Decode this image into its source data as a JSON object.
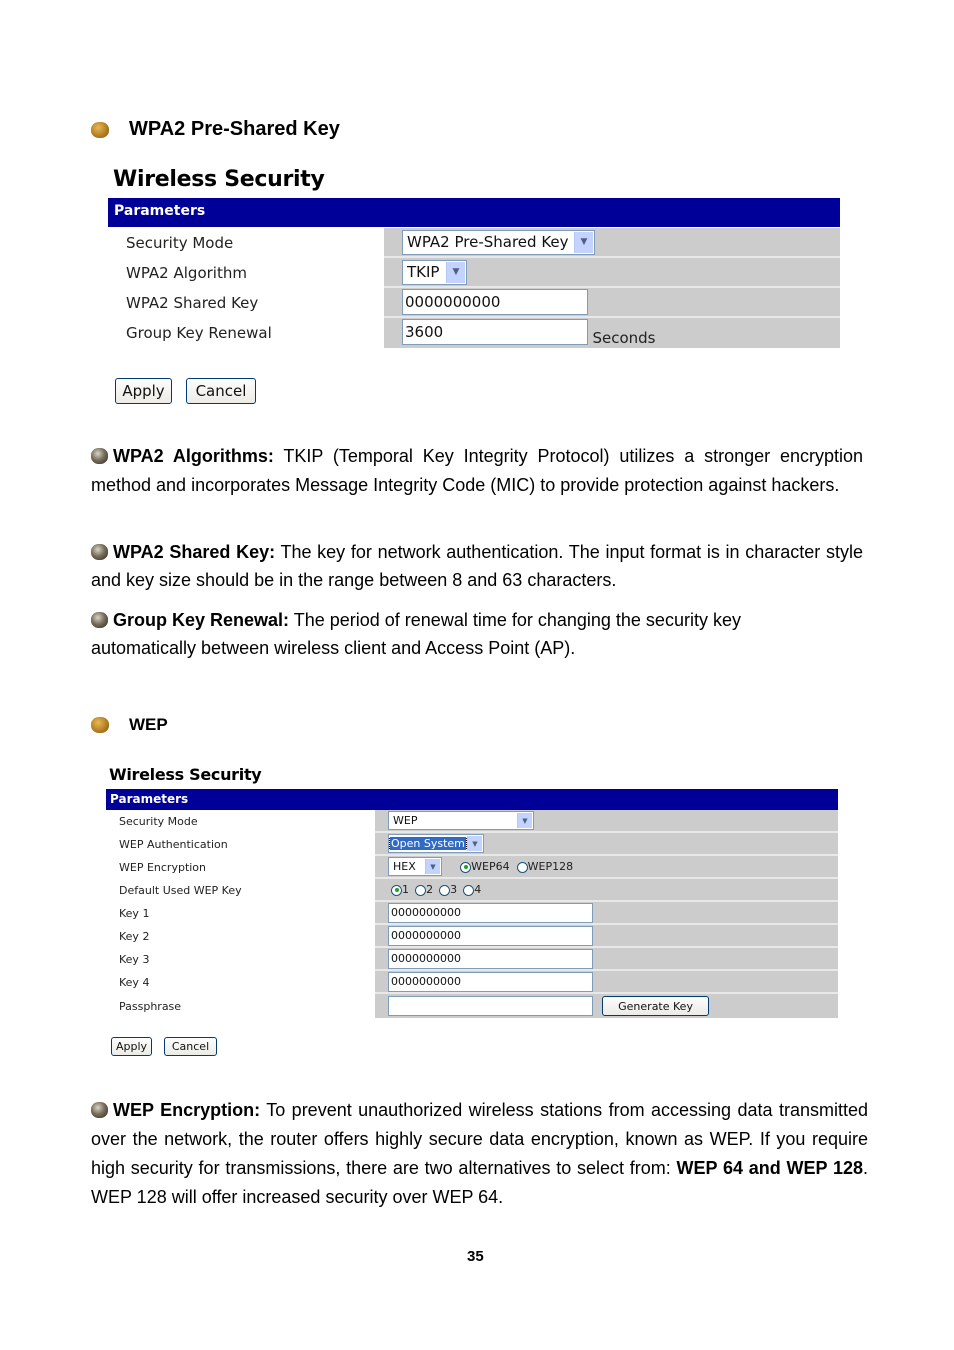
{
  "sections": {
    "wpa2": {
      "heading": "WPA2 Pre-Shared Key",
      "panel": {
        "title": "Wireless Security",
        "bar_label": "Parameters",
        "rows": [
          {
            "label": "Security Mode",
            "value": "WPA2 Pre-Shared Key",
            "type": "select"
          },
          {
            "label": "WPA2 Algorithm",
            "value": "TKIP",
            "type": "select"
          },
          {
            "label": "WPA2 Shared Key",
            "value": "0000000000",
            "type": "text"
          },
          {
            "label": "Group Key Renewal",
            "value": "3600",
            "type": "text",
            "suffix": "Seconds"
          }
        ],
        "apply_label": "Apply",
        "cancel_label": "Cancel"
      },
      "descriptions": [
        {
          "term": "WPA2 Algorithms:",
          "text": " TKIP (Temporal Key Integrity Protocol) utilizes a stronger encryption method and incorporates Message Integrity Code (MIC) to provide protection against hackers."
        },
        {
          "term": "WPA2 Shared Key:",
          "text": " The key for network authentication. The input format is in character style and key size should be in the range between 8 and 63 characters."
        },
        {
          "term": "Group Key Renewal:",
          "text": " The period of renewal time for changing the security key automatically between wireless client and Access Point (AP)."
        }
      ]
    },
    "wep": {
      "heading": "WEP",
      "panel": {
        "title": "Wireless Security",
        "bar_label": "Parameters",
        "security_mode": {
          "label": "Security Mode",
          "value": "WEP"
        },
        "authentication": {
          "label": "WEP Authentication",
          "value": "Open System"
        },
        "encryption": {
          "label": "WEP Encryption",
          "format": "HEX",
          "options": [
            "WEP64",
            "WEP128"
          ],
          "selected": "WEP64"
        },
        "default_key": {
          "label": "Default Used WEP Key",
          "options": [
            "1",
            "2",
            "3",
            "4"
          ],
          "selected": "1"
        },
        "keys": [
          {
            "label": "Key 1",
            "value": "0000000000"
          },
          {
            "label": "Key 2",
            "value": "0000000000"
          },
          {
            "label": "Key 3",
            "value": "0000000000"
          },
          {
            "label": "Key 4",
            "value": "0000000000"
          }
        ],
        "passphrase": {
          "label": "Passphrase",
          "value": "",
          "generate_label": "Generate Key"
        },
        "apply_label": "Apply",
        "cancel_label": "Cancel"
      },
      "description": {
        "term": "WEP Encryption:",
        "text1": " To prevent unauthorized wireless stations from accessing data transmitted over the network, the router offers highly secure data encryption, known as WEP. If you require high security for transmissions, there are two alternatives to select from: ",
        "bold2": "WEP 64 and WEP 128",
        "text2": ". WEP 128 will offer increased security over WEP 64."
      }
    }
  },
  "page_number": "35",
  "colors": {
    "parameter_bar": "#000099",
    "control_cell": "#cccccc"
  }
}
